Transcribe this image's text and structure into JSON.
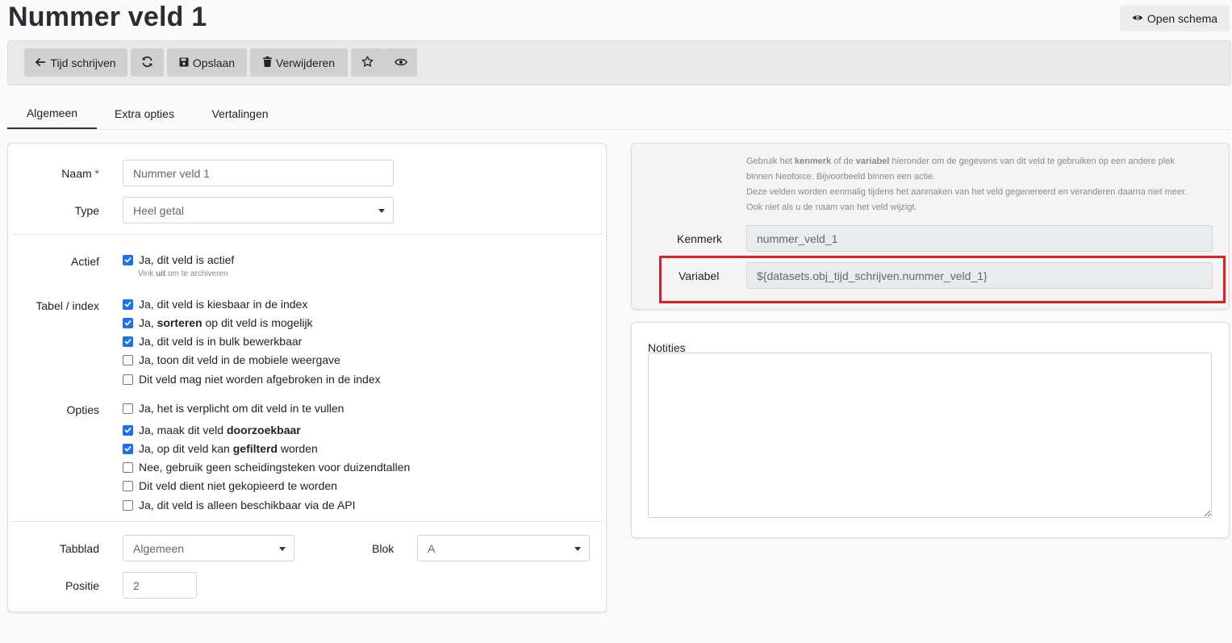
{
  "header": {
    "title": "Nummer veld 1",
    "open_schema_label": "Open schema"
  },
  "toolbar": {
    "back_label": "Tijd schrijven",
    "save_label": "Opslaan",
    "delete_label": "Verwijderen"
  },
  "tabs": [
    {
      "label": "Algemeen",
      "active": true
    },
    {
      "label": "Extra opties",
      "active": false
    },
    {
      "label": "Vertalingen",
      "active": false
    }
  ],
  "form": {
    "naam_label": "Naam",
    "naam_required_mark": "*",
    "naam_value": "Nummer veld 1",
    "type_label": "Type",
    "type_value": "Heel getal",
    "actief_label": "Actief",
    "actief_checkbox": {
      "label": "Ja, dit veld is actief",
      "checked": true
    },
    "actief_hint_pre": "Vink ",
    "actief_hint_bold": "uit",
    "actief_hint_post": " om te archiveren",
    "tabel_label": "Tabel / index",
    "tabel_options": [
      {
        "pre": "Ja, dit veld is kiesbaar in de index",
        "bold": "",
        "post": "",
        "checked": true
      },
      {
        "pre": "Ja, ",
        "bold": "sorteren",
        "post": " op dit veld is mogelijk",
        "checked": true
      },
      {
        "pre": "Ja, dit veld is in bulk bewerkbaar",
        "bold": "",
        "post": "",
        "checked": true
      },
      {
        "pre": "Ja, toon dit veld in de mobiele weergave",
        "bold": "",
        "post": "",
        "checked": false
      },
      {
        "pre": "Dit veld mag niet worden afgebroken in de index",
        "bold": "",
        "post": "",
        "checked": false
      }
    ],
    "opties_label": "Opties",
    "opties_options": [
      {
        "pre": "Ja, het is verplicht om dit veld in te vullen",
        "bold": "",
        "post": "",
        "checked": false
      },
      {
        "pre": "Ja, maak dit veld ",
        "bold": "doorzoekbaar",
        "post": "",
        "checked": true
      },
      {
        "pre": "Ja, op dit veld kan ",
        "bold": "gefilterd",
        "post": " worden",
        "checked": true
      },
      {
        "pre": "Nee, gebruik geen scheidingsteken voor duizendtallen",
        "bold": "",
        "post": "",
        "checked": false
      },
      {
        "pre": "Dit veld dient niet gekopieerd te worden",
        "bold": "",
        "post": "",
        "checked": false
      },
      {
        "pre": "Ja, dit veld is alleen beschikbaar via de API",
        "bold": "",
        "post": "",
        "checked": false
      }
    ],
    "tabblad_label": "Tabblad",
    "tabblad_value": "Algemeen",
    "blok_label": "Blok",
    "blok_value": "A",
    "positie_label": "Positie",
    "positie_value": "2"
  },
  "info": {
    "l1_a": "Gebruik het ",
    "l1_b": "kenmerk",
    "l1_c": " of de ",
    "l1_d": "variabel",
    "l1_e": " hieronder om de gegevens van dit veld te gebruiken op een andere plek",
    "l2": "binnen Neoforce. Bijvoorbeeld binnen een actie.",
    "l3": "Deze velden worden eenmalig tijdens het aanmaken van het veld gegenereerd en veranderen daarna niet meer.",
    "l4": "Ook niet als u de naam van het veld wijzigt.",
    "kenmerk_label": "Kenmerk",
    "kenmerk_value": "nummer_veld_1",
    "variabel_label": "Variabel",
    "variabel_value": "${datasets.obj_tijd_schrijven.nummer_veld_1}"
  },
  "notes": {
    "label": "Notities",
    "value": ""
  },
  "colors": {
    "checkbox_checked": "#1a73e8",
    "highlight_border": "#e02020",
    "toolbar_button": "#d0d0d0"
  }
}
